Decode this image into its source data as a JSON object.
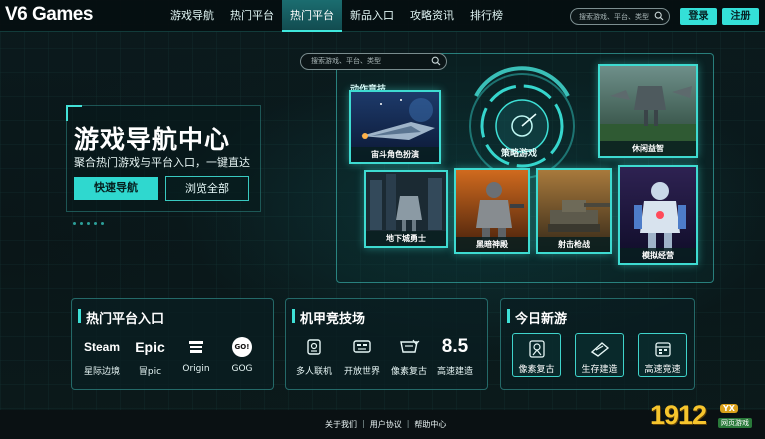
{
  "brand": {
    "logo": "V6 Games"
  },
  "nav": {
    "items": [
      "游戏导航",
      "热门平台",
      "热门平台",
      "新品入口",
      "攻略资讯",
      "排行榜"
    ],
    "active_index": 2
  },
  "top_search": {
    "placeholder": "搜索游戏、平台、类型"
  },
  "auth": {
    "login": "登录",
    "register": "注册"
  },
  "hero": {
    "title": "游戏导航中心",
    "subtitle": "聚合热门游戏与平台入口，一键直达",
    "btn_quick": "快速导航",
    "btn_browse": "浏览全部"
  },
  "showcase": {
    "search_placeholder": "搜索游戏、平台、类型",
    "category_label": "动作竞技",
    "hud_label": "策略游戏",
    "cards": [
      "宙斗角色扮演",
      "休闲益智",
      "地下城勇士",
      "黑暗神殿",
      "射击枪战",
      "模拟经营"
    ]
  },
  "panels": {
    "platforms": {
      "title": "热门平台入口",
      "items": [
        {
          "brand": "Steam",
          "label": "星际边境"
        },
        {
          "brand": "Epic",
          "label": "冒pic"
        },
        {
          "brand": "",
          "label": "Origin",
          "icon": "origin-icon"
        },
        {
          "brand": "GO!",
          "label": "GOG"
        }
      ]
    },
    "mecha": {
      "title": "机甲竞技场",
      "items": [
        {
          "label": "多人联机",
          "icon": "multiplayer-icon"
        },
        {
          "label": "开放世界",
          "icon": "open-world-icon"
        },
        {
          "label": "像素复古",
          "icon": "pixel-icon"
        },
        {
          "label": "高速建造",
          "value": "8.5"
        }
      ]
    },
    "new_games": {
      "title": "今日新游",
      "items": [
        {
          "label": "像素复古",
          "icon": "map-pin-icon"
        },
        {
          "label": "生存建造",
          "icon": "build-icon"
        },
        {
          "label": "高速竞速",
          "icon": "calendar-icon"
        }
      ]
    }
  },
  "footer": {
    "links": [
      "关于我们",
      "用户协议",
      "帮助中心"
    ],
    "separator": "|"
  },
  "watermark": {
    "number": "1912",
    "tag": "YX",
    "sub": "网页游戏"
  },
  "colors": {
    "accent": "#34e0d8",
    "background": "#0b1719",
    "watermark": "#f6c52d"
  }
}
